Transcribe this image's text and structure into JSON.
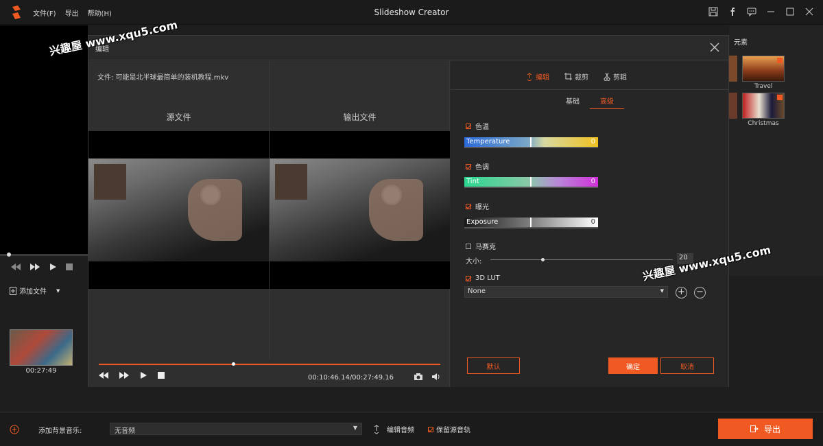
{
  "app": {
    "title": "Slideshow Creator",
    "menu": [
      "文件(F)",
      "导出",
      "帮助(H)"
    ],
    "accent_color": "#f05a22"
  },
  "watermarks": [
    "兴趣屋 www.xqu5.com",
    "兴趣屋 www.xqu5.com"
  ],
  "left": {
    "add_file": "添加文件",
    "thumb_time": "00:27:49"
  },
  "right_panel": {
    "label": "元素",
    "items": [
      {
        "name": "Travel"
      },
      {
        "name": "Christmas"
      }
    ]
  },
  "bottom": {
    "bgm_label": "添加背景音乐:",
    "bgm_value": "无音频",
    "edit_audio": "编辑音频",
    "keep_track": "保留源音轨",
    "export": "导出"
  },
  "dialog": {
    "title": "编辑",
    "file_label": "文件: 可能是北半球最简单的装机教程.mkv",
    "source_label": "源文件",
    "output_label": "输出文件",
    "timecode": "00:10:46.14/00:27:49.16",
    "playback_progress": 0.39,
    "tabs": [
      "编辑",
      "裁剪",
      "剪辑"
    ],
    "subtabs": [
      "基础",
      "高级"
    ],
    "temperature": {
      "label": "色温",
      "bar_label": "Temperature",
      "value": "0",
      "checked": true
    },
    "tint": {
      "label": "色调",
      "bar_label": "Tint",
      "value": "0",
      "checked": true
    },
    "exposure": {
      "label": "曝光",
      "bar_label": "Exposure",
      "value": "0",
      "checked": true
    },
    "mosaic": {
      "label": "马赛克",
      "checked": false,
      "size_label": "大小:",
      "size_value": "20"
    },
    "lut": {
      "label": "3D LUT",
      "checked": true,
      "value": "None"
    },
    "buttons": {
      "default": "默认",
      "ok": "确定",
      "cancel": "取消"
    }
  }
}
